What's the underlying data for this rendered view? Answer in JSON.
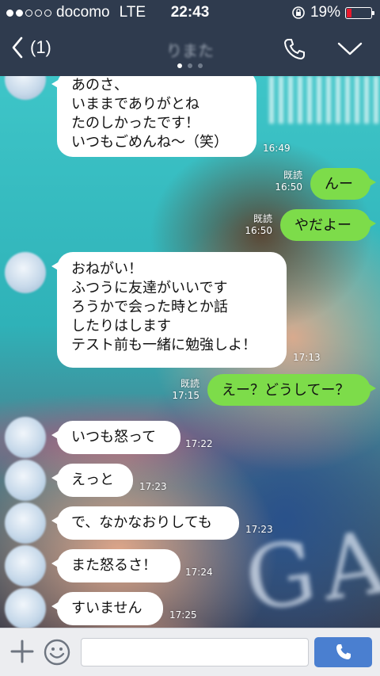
{
  "status_bar": {
    "carrier": "docomo",
    "network": "LTE",
    "time": "22:43",
    "battery_percent": "19%",
    "battery_level": 0.19,
    "signal_bars_filled": 2,
    "signal_bars_total": 5
  },
  "nav": {
    "back_count": "(1)",
    "title": "りまた",
    "page_count": 3,
    "active_page": 0,
    "icons": [
      "back-chevron-icon",
      "phone-icon",
      "chevron-down-icon"
    ]
  },
  "messages": [
    {
      "side": "in",
      "text": "あのさ、\nいままでありがとね\nたのしかったです！\nいつもごめんね〜（笑）",
      "time": "16:49"
    },
    {
      "side": "out",
      "text": "んー",
      "read": "既読",
      "time": "16:50"
    },
    {
      "side": "out",
      "text": "やだよー",
      "read": "既読",
      "time": "16:50"
    },
    {
      "side": "in",
      "text": "おねがい！\nふつうに友達がいいです\nろうかで会った時とか話\nしたりはします\nテスト前も一緒に勉強しよ！",
      "time": "17:13"
    },
    {
      "side": "out",
      "text": "えー？どうしてー？",
      "read": "既読",
      "time": "17:15"
    },
    {
      "side": "in",
      "text": "いつも怒って",
      "time": "17:22"
    },
    {
      "side": "in",
      "text": "えっと",
      "time": "17:23"
    },
    {
      "side": "in",
      "text": "で、なかなおりしても",
      "time": "17:23"
    },
    {
      "side": "in",
      "text": "また怒るさ！",
      "time": "17:24"
    },
    {
      "side": "in",
      "text": "すいません",
      "time": "17:25"
    }
  ],
  "input_bar": {
    "value": "",
    "placeholder": "",
    "icons": [
      "plus-icon",
      "emoji-icon",
      "phone-send-icon"
    ]
  },
  "colors": {
    "header_bg": "#2f3b4e",
    "outgoing_bubble": "#7ddc4a",
    "incoming_bubble": "#ffffff",
    "send_button": "#4a7fd0",
    "battery_low": "#e8192c"
  }
}
